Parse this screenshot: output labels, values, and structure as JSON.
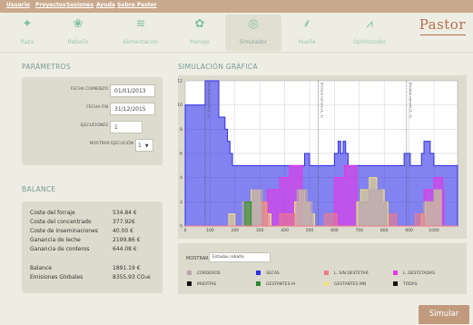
{
  "menu": [
    "Usuario",
    "Proyectos",
    "Sesiones",
    "Ayuda",
    "Sobre Pastor"
  ],
  "tabs": [
    {
      "label": "Raza",
      "icon": "breed-icon"
    },
    {
      "label": "Rebaño",
      "icon": "flock-icon"
    },
    {
      "label": "Alimentación",
      "icon": "feed-icon"
    },
    {
      "label": "Manejo",
      "icon": "management-icon"
    },
    {
      "label": "Simulador",
      "icon": "simulator-icon"
    },
    {
      "label": "Huella",
      "icon": "footprint-icon"
    },
    {
      "label": "Optimizador",
      "icon": "optimizer-icon"
    }
  ],
  "logo": "Pastor",
  "parametros": {
    "title": "PARÁMETROS",
    "fecha_comienzo_label": "FECHA COMIENZO",
    "fecha_comienzo": "01/01/2013",
    "fecha_fin_label": "FECHA FIN",
    "fecha_fin": "31/12/2015",
    "ejecuciones_label": "EJECUCIONES",
    "ejecuciones": "1",
    "mostrar_label": "MOSTRAR EJECUCIÓN",
    "mostrar_value": "1"
  },
  "balance": {
    "title": "BALANCE",
    "rows": [
      {
        "label": "Coste del forraje",
        "value": "534.84 €"
      },
      {
        "label": "Coste del concentrado",
        "value": "377.92€"
      },
      {
        "label": "Coste de inseminaciones",
        "value": "40.00 €"
      },
      {
        "label": "Ganancia de leche",
        "value": "2199.86 €"
      },
      {
        "label": "Ganancia de corderos",
        "value": "644.08 €"
      }
    ],
    "balance_label": "Balance",
    "balance_value": "1891.19 €",
    "emisiones_label": "Emisiones Globales",
    "emisiones_value": "8355.93 CO₂e"
  },
  "simulacion": {
    "title": "SIMULACIÓN GRÁFICA",
    "mostrar_label": "MOSTRAR:",
    "mostrar_value": "Estados rebaño",
    "legend": [
      {
        "name": "CORDEROS",
        "color": "#b9a6b0"
      },
      {
        "name": "SECAS",
        "color": "#2f2fe6"
      },
      {
        "name": "L. SIN DESTETAR",
        "color": "#f07a87"
      },
      {
        "name": "L. DESTETADAS",
        "color": "#e636e6"
      },
      {
        "name": "MUERTAS",
        "color": "#111111"
      },
      {
        "name": "GESTANTES IA",
        "color": "#2a8a2a"
      },
      {
        "name": "GESTANTES MN",
        "color": "#f5e27a"
      },
      {
        "name": "TODAS",
        "color": "#111111"
      }
    ],
    "marker_label": "Entrada carnero (1, 1)"
  },
  "chart_data": {
    "type": "area",
    "xlim": [
      0,
      1095
    ],
    "ylim": [
      0,
      12
    ],
    "xticks": [
      0,
      100,
      200,
      300,
      400,
      500,
      600,
      700,
      800,
      900,
      1000
    ],
    "yticks": [
      0,
      2,
      4,
      6,
      8,
      10,
      12
    ],
    "grid": true,
    "markers_x": [
      80,
      535,
      890
    ],
    "series": [
      {
        "name": "TODAS",
        "color": "#2f2fe6",
        "steps": [
          [
            0,
            10
          ],
          [
            80,
            10
          ],
          [
            80,
            12
          ],
          [
            135,
            12
          ],
          [
            135,
            9
          ],
          [
            160,
            9
          ],
          [
            160,
            8
          ],
          [
            170,
            8
          ],
          [
            170,
            7
          ],
          [
            180,
            7
          ],
          [
            180,
            6
          ],
          [
            190,
            6
          ],
          [
            190,
            5
          ],
          [
            480,
            5
          ],
          [
            480,
            6
          ],
          [
            500,
            6
          ],
          [
            500,
            5
          ],
          [
            520,
            5
          ],
          [
            520,
            5
          ],
          [
            600,
            5
          ],
          [
            600,
            6
          ],
          [
            615,
            6
          ],
          [
            615,
            7
          ],
          [
            625,
            7
          ],
          [
            625,
            6
          ],
          [
            635,
            6
          ],
          [
            635,
            7
          ],
          [
            645,
            7
          ],
          [
            645,
            6
          ],
          [
            655,
            6
          ],
          [
            655,
            5
          ],
          [
            880,
            5
          ],
          [
            880,
            6
          ],
          [
            905,
            6
          ],
          [
            905,
            5
          ],
          [
            950,
            5
          ],
          [
            950,
            6
          ],
          [
            960,
            6
          ],
          [
            960,
            7
          ],
          [
            985,
            7
          ],
          [
            985,
            6
          ],
          [
            1000,
            6
          ],
          [
            1000,
            5
          ],
          [
            1095,
            5
          ]
        ]
      },
      {
        "name": "L. DESTETADAS",
        "color": "#e636e6",
        "steps": [
          [
            0,
            0
          ],
          [
            330,
            0
          ],
          [
            330,
            3
          ],
          [
            380,
            3
          ],
          [
            380,
            4
          ],
          [
            420,
            4
          ],
          [
            420,
            5
          ],
          [
            470,
            5
          ],
          [
            470,
            0
          ],
          [
            600,
            0
          ],
          [
            600,
            4
          ],
          [
            640,
            4
          ],
          [
            640,
            5
          ],
          [
            690,
            5
          ],
          [
            690,
            0
          ],
          [
            960,
            0
          ],
          [
            960,
            3
          ],
          [
            1000,
            3
          ],
          [
            1000,
            4
          ],
          [
            1035,
            4
          ],
          [
            1035,
            3
          ],
          [
            1040,
            3
          ],
          [
            1040,
            0
          ],
          [
            1095,
            0
          ]
        ]
      },
      {
        "name": "GESTANTES MN",
        "color": "#f5e27a",
        "steps": [
          [
            0,
            0
          ],
          [
            175,
            0
          ],
          [
            175,
            1
          ],
          [
            200,
            1
          ],
          [
            200,
            0
          ],
          [
            240,
            0
          ],
          [
            240,
            2
          ],
          [
            265,
            2
          ],
          [
            265,
            3
          ],
          [
            300,
            3
          ],
          [
            300,
            2
          ],
          [
            325,
            2
          ],
          [
            325,
            1
          ],
          [
            345,
            1
          ],
          [
            345,
            0
          ],
          [
            440,
            0
          ],
          [
            440,
            2
          ],
          [
            460,
            2
          ],
          [
            460,
            3
          ],
          [
            480,
            3
          ],
          [
            480,
            2
          ],
          [
            500,
            2
          ],
          [
            500,
            1
          ],
          [
            520,
            1
          ],
          [
            520,
            0
          ],
          [
            690,
            0
          ],
          [
            690,
            2
          ],
          [
            705,
            2
          ],
          [
            705,
            3
          ],
          [
            740,
            3
          ],
          [
            740,
            4
          ],
          [
            770,
            4
          ],
          [
            770,
            3
          ],
          [
            800,
            3
          ],
          [
            800,
            2
          ],
          [
            815,
            2
          ],
          [
            815,
            0
          ],
          [
            950,
            0
          ],
          [
            950,
            1
          ],
          [
            965,
            1
          ],
          [
            965,
            2
          ],
          [
            1000,
            2
          ],
          [
            1000,
            3
          ],
          [
            1030,
            3
          ],
          [
            1030,
            0
          ],
          [
            1095,
            0
          ]
        ]
      },
      {
        "name": "CORDEROS",
        "color": "#b9a6b0",
        "steps": [
          [
            0,
            0
          ],
          [
            230,
            0
          ],
          [
            230,
            2
          ],
          [
            270,
            2
          ],
          [
            270,
            3
          ],
          [
            310,
            3
          ],
          [
            310,
            2
          ],
          [
            320,
            2
          ],
          [
            320,
            0
          ],
          [
            450,
            0
          ],
          [
            450,
            3
          ],
          [
            490,
            3
          ],
          [
            490,
            2
          ],
          [
            510,
            2
          ],
          [
            510,
            0
          ],
          [
            700,
            0
          ],
          [
            700,
            2
          ],
          [
            740,
            2
          ],
          [
            740,
            3
          ],
          [
            790,
            3
          ],
          [
            790,
            2
          ],
          [
            810,
            2
          ],
          [
            810,
            0
          ],
          [
            960,
            0
          ],
          [
            960,
            2
          ],
          [
            1000,
            2
          ],
          [
            1000,
            3
          ],
          [
            1030,
            3
          ],
          [
            1030,
            0
          ],
          [
            1095,
            0
          ]
        ]
      },
      {
        "name": "GESTANTES IA",
        "color": "#2a8a2a",
        "steps": [
          [
            0,
            0
          ],
          [
            240,
            0
          ],
          [
            240,
            2
          ],
          [
            265,
            2
          ],
          [
            265,
            0
          ],
          [
            1095,
            0
          ]
        ]
      },
      {
        "name": "L. SIN DESTETAR",
        "color": "#f07a87",
        "steps": [
          [
            0,
            0
          ],
          [
            310,
            0
          ],
          [
            310,
            2
          ],
          [
            330,
            2
          ],
          [
            330,
            0
          ],
          [
            380,
            0
          ],
          [
            380,
            1
          ],
          [
            440,
            1
          ],
          [
            440,
            0
          ],
          [
            560,
            0
          ],
          [
            560,
            1
          ],
          [
            610,
            1
          ],
          [
            610,
            0
          ],
          [
            820,
            0
          ],
          [
            820,
            1
          ],
          [
            850,
            1
          ],
          [
            850,
            0
          ],
          [
            925,
            0
          ],
          [
            925,
            1
          ],
          [
            960,
            1
          ],
          [
            960,
            0
          ],
          [
            1095,
            0
          ]
        ]
      }
    ]
  },
  "simular_button": "Simular"
}
